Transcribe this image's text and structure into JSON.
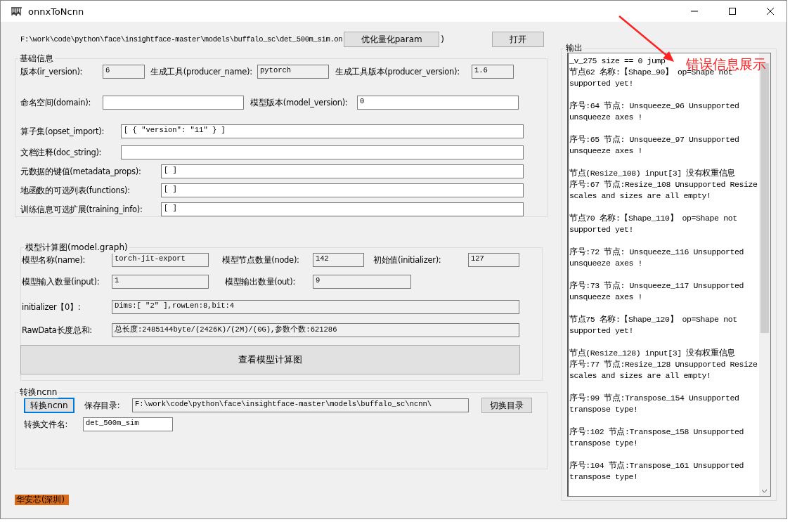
{
  "window": {
    "title": "onnxToNcnn"
  },
  "file": {
    "path": "F:\\work\\code\\python\\face\\insightface-master\\models\\buffalo_sc\\det_500m_sim.on",
    "optimize_button": "优化量化param",
    "paren": ")",
    "open_button": "打开"
  },
  "basic_info": {
    "title": "基础信息",
    "rows": [
      [
        {
          "label": "版本(ir_version):",
          "value": "6",
          "readonly": true
        },
        {
          "label": "生成工具(producer_name):",
          "value": "pytorch",
          "readonly": true
        },
        {
          "label": "生成工具版本(producer_version):",
          "value": "1.6",
          "readonly": true
        }
      ],
      [
        {
          "label": "命名空间(domain):",
          "readonly": false
        },
        {
          "label": "模型版本(model_version):",
          "value": "0",
          "readonly": false
        }
      ],
      [
        {
          "label": "算子集(opset_import):",
          "value": "[ { \"version\": \"11\" } ]",
          "readonly": false
        }
      ],
      [
        {
          "label": "文档注释(doc_string):",
          "readonly": false
        }
      ],
      [
        {
          "label": "元数据的键值(metadata_props):",
          "value": "[ ]",
          "readonly": false
        }
      ],
      [
        {
          "label": "地函数的可选列表(functions):",
          "value": "[ ]",
          "readonly": false
        }
      ],
      [
        {
          "label": "训练信息可选扩展(training_info):",
          "value": "[ ]",
          "readonly": false
        }
      ]
    ]
  },
  "graph": {
    "title": "模型计算图(model.graph)",
    "rows": [
      [
        {
          "label": "模型名称(name):",
          "value": "torch-jit-export",
          "readonly": true
        },
        {
          "label": "模型节点数量(node):",
          "value": "142",
          "readonly": true
        },
        {
          "label": "初始值(initializer):",
          "value": "127",
          "readonly": true
        }
      ],
      [
        {
          "label": "模型输入数量(input):",
          "value": "1",
          "readonly": true
        },
        {
          "label": "模型输出数量(out):",
          "value": "9",
          "readonly": true
        }
      ],
      [
        {
          "label": "initializer【0】:",
          "value": "Dims:[ \"2\" ],rowLen:8,bit:4",
          "readonly": true
        }
      ],
      [
        {
          "label": "RawData长度总和:",
          "value": "总长度:2485144byte/(2426K)/(2M)/(0G),参数个数:621286",
          "readonly": true
        }
      ]
    ],
    "view_button": "查看模型计算图"
  },
  "convert": {
    "title": "转换ncnn",
    "convert_button": {
      "label": "转换ncnn",
      "focused": true
    },
    "save_dir_label": "保存目录:",
    "save_dir": "F:\\work\\code\\python\\face\\insightface-master\\models\\buffalo_sc\\ncnn\\",
    "switch_button": "切换目录",
    "file_name_label": "转换文件名:",
    "file_name": "det_500m_sim"
  },
  "footer": {
    "badge": "华安芯(深圳)"
  },
  "output": {
    "title": "输出",
    "blocks": [
      [
        "_v_275 size == 0 jump",
        "节点62 名称:【Shape_90】 op=Shape not supported yet!"
      ],
      [
        "序号:64 节点: Unsqueeze_96 Unsupported unsqueeze axes !"
      ],
      [
        "序号:65 节点: Unsqueeze_97 Unsupported unsqueeze axes !"
      ],
      [
        "节点(Resize_108) input[3] 没有权重信息",
        "序号:67 节点:Resize_108 Unsupported Resize scales and sizes are all empty!"
      ],
      [
        "节点70 名称:【Shape_110】 op=Shape not supported yet!"
      ],
      [
        "序号:72 节点: Unsqueeze_116 Unsupported unsqueeze axes !"
      ],
      [
        "序号:73 节点: Unsqueeze_117 Unsupported unsqueeze axes !"
      ],
      [
        "节点75 名称:【Shape_120】 op=Shape not supported yet!"
      ],
      [
        "节点(Resize_128) input[3] 没有权重信息",
        "序号:77 节点:Resize_128 Unsupported Resize scales and sizes are all empty!"
      ],
      [
        "序号:99 节点:Transpose_154 Unsupported transpose type!"
      ],
      [
        "序号:102 节点:Transpose_158 Unsupported transpose type!"
      ],
      [
        "序号:104 节点:Transpose_161 Unsupported transpose type!"
      ]
    ]
  },
  "annotation": {
    "text": "错误信息展示"
  }
}
